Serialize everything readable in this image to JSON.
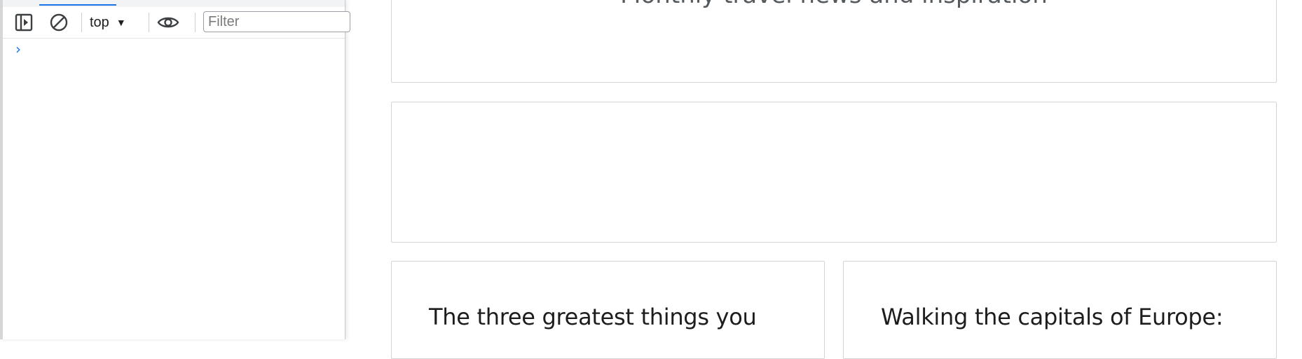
{
  "devtools": {
    "context_label": "top",
    "filter_placeholder": "Filter",
    "filter_value": "",
    "prompt_symbol": "›",
    "icons": [
      "sidebar-toggle-icon",
      "clear-console-icon",
      "eye-icon",
      "caret-down-icon"
    ],
    "accent_color": "#1a73e8"
  },
  "page": {
    "hero_subtitle": "Monthly travel news and inspiration",
    "articles": [
      {
        "title": "The three greatest things you"
      },
      {
        "title": "Walking the capitals of Europe:"
      }
    ]
  }
}
